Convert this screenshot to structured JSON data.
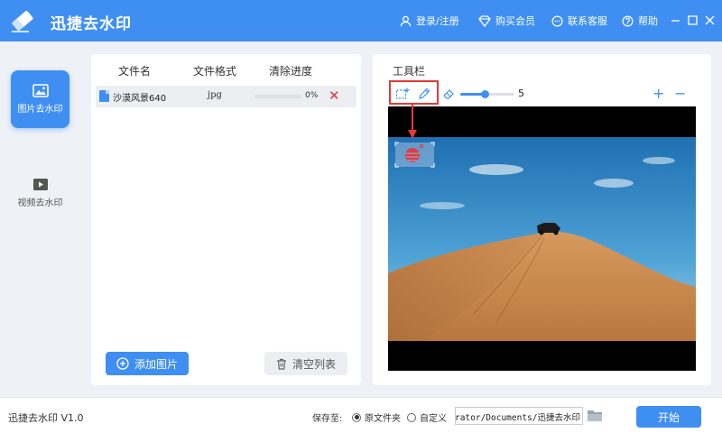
{
  "app": {
    "title": "迅捷去水印",
    "version_text": "迅捷去水印 V1.0"
  },
  "titlebar": {
    "login": "登录/注册",
    "vip": "购买会员",
    "service": "联系客服",
    "help": "帮助"
  },
  "sidebar": {
    "items": [
      {
        "label": "图片去水印",
        "icon": "image-icon",
        "active": true
      },
      {
        "label": "视频去水印",
        "icon": "video-icon",
        "active": false
      }
    ]
  },
  "file_list": {
    "headers": [
      "文件名",
      "文件格式",
      "清除进度"
    ],
    "rows": [
      {
        "name": "沙漠风景640",
        "format": "jpg",
        "progress_percent": 0,
        "progress_text": "0%"
      }
    ],
    "add_label": "添加图片",
    "clear_label": "清空列表"
  },
  "toolbar": {
    "title": "工具栏",
    "brush_size": "5",
    "brush_size_fraction": 0.45,
    "zoom_in": "+",
    "zoom_out": "−"
  },
  "bottom": {
    "save_label": "保存至:",
    "option_original": "原文件夹",
    "option_custom": "自定义",
    "path": "C:/Users/Administrator/Documents/迅捷去水印",
    "start_label": "开始"
  },
  "colors": {
    "accent": "#3f8ff3",
    "highlight": "#e53935"
  }
}
